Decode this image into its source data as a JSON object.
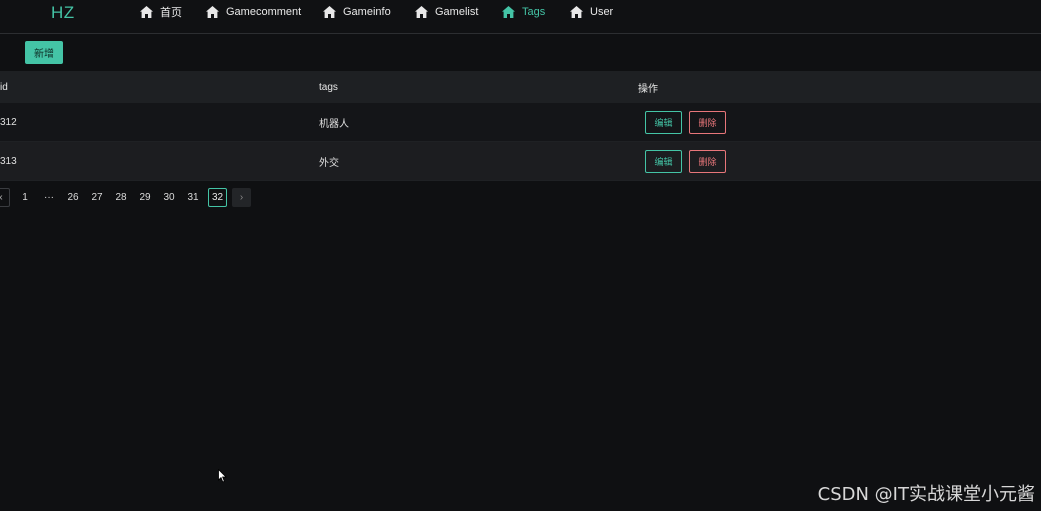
{
  "app": {
    "logo": "HZ",
    "accent": "#44c4a6",
    "danger": "#e8767a"
  },
  "nav": [
    {
      "label": "首页",
      "icon": "home-icon",
      "active": false
    },
    {
      "label": "Gamecomment",
      "icon": "home-icon",
      "active": false
    },
    {
      "label": "Gameinfo",
      "icon": "home-icon",
      "active": false
    },
    {
      "label": "Gamelist",
      "icon": "home-icon",
      "active": false
    },
    {
      "label": "Tags",
      "icon": "home-icon",
      "active": true
    },
    {
      "label": "User",
      "icon": "home-icon",
      "active": false
    }
  ],
  "toolbar": {
    "add_label": "新增"
  },
  "table": {
    "columns": [
      "id",
      "tags",
      "操作"
    ],
    "rows": [
      {
        "id": "312",
        "tags": "机器人",
        "edit": "编辑",
        "delete": "删除"
      },
      {
        "id": "313",
        "tags": "外交",
        "edit": "编辑",
        "delete": "删除"
      }
    ]
  },
  "pagination": {
    "prev": "‹",
    "pages": [
      "1",
      "···",
      "26",
      "27",
      "28",
      "29",
      "30",
      "31",
      "32"
    ],
    "current": "32",
    "next": "›"
  },
  "watermark": "CSDN @IT实战课堂小元酱"
}
